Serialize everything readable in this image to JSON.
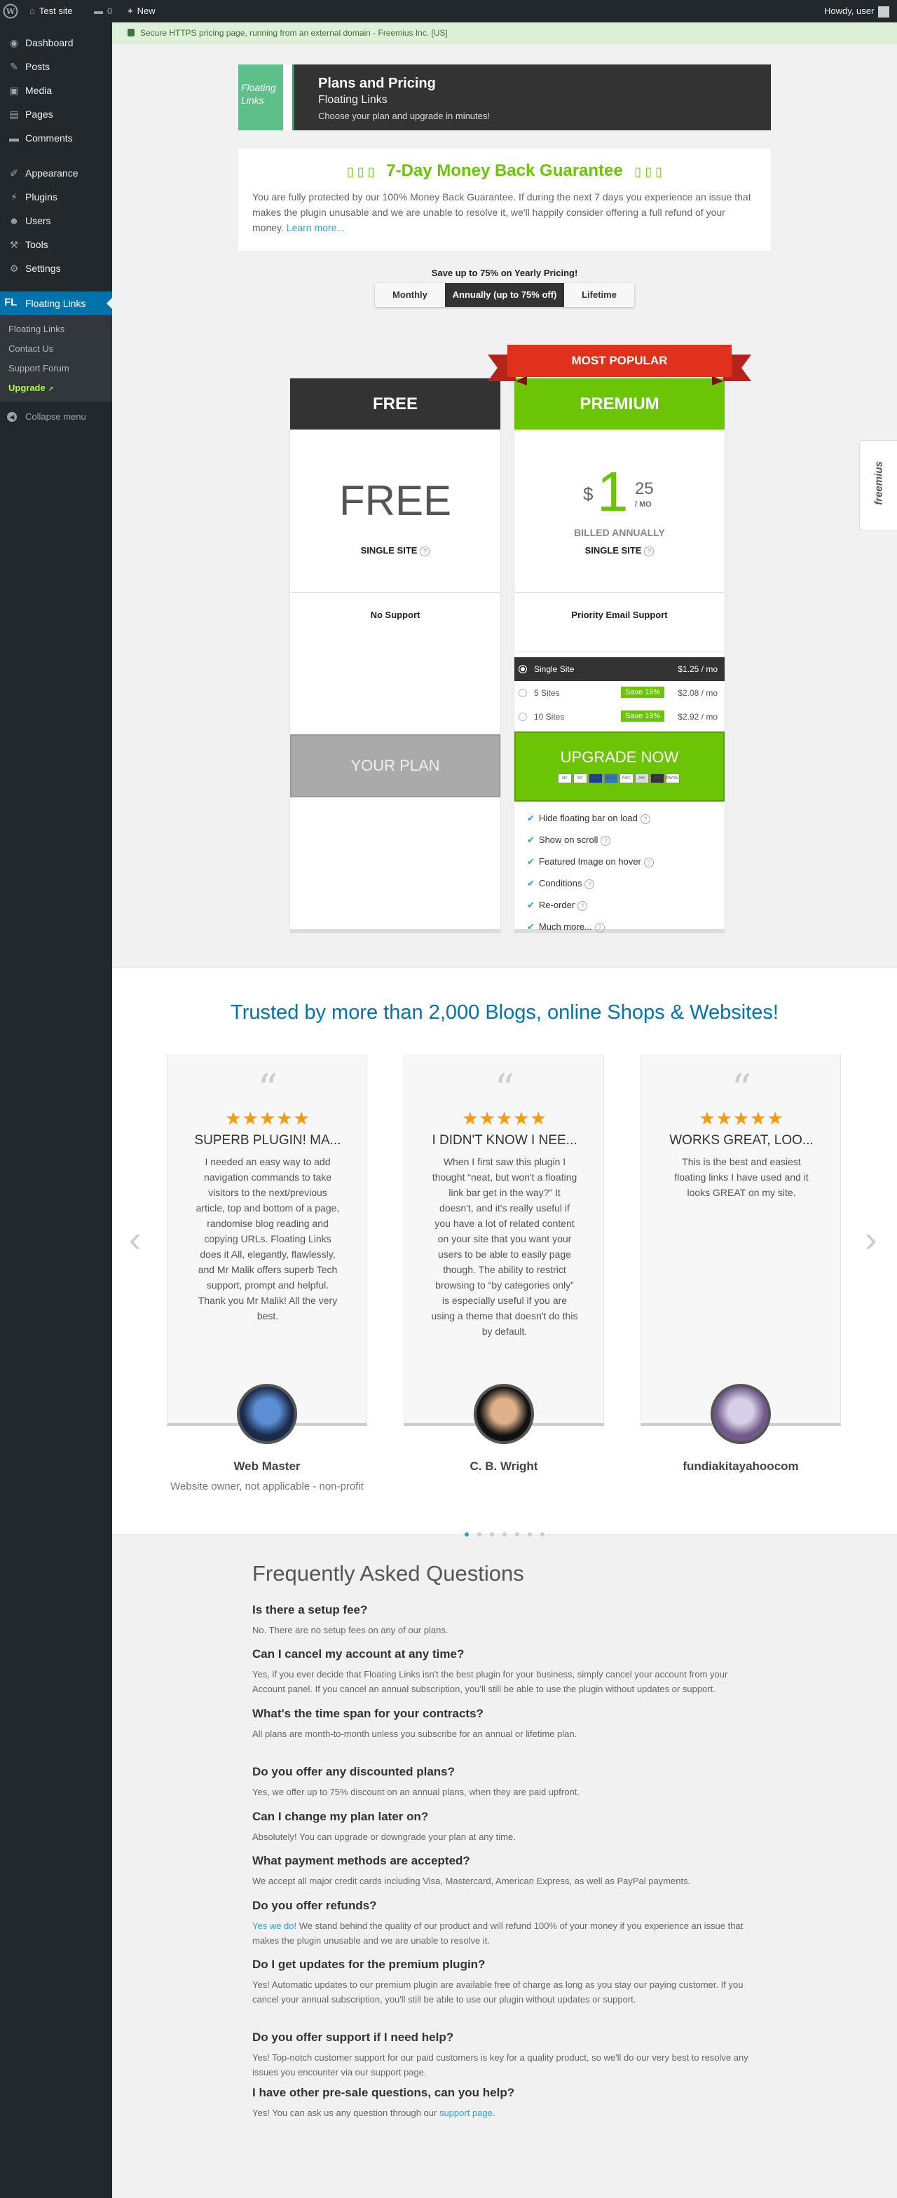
{
  "adminbar": {
    "site": "Test site",
    "comments_count": "0",
    "new_label": "New",
    "howdy": "Howdy, user"
  },
  "sidebar": {
    "items": [
      {
        "label": "Dashboard",
        "icon": "dashboard-icon"
      },
      {
        "label": "Posts",
        "icon": "pin-icon"
      },
      {
        "label": "Media",
        "icon": "media-icon"
      },
      {
        "label": "Pages",
        "icon": "pages-icon"
      },
      {
        "label": "Comments",
        "icon": "comments-icon"
      },
      {
        "label": "Appearance",
        "icon": "brush-icon"
      },
      {
        "label": "Plugins",
        "icon": "plugin-icon"
      },
      {
        "label": "Users",
        "icon": "users-icon"
      },
      {
        "label": "Tools",
        "icon": "wrench-icon"
      },
      {
        "label": "Settings",
        "icon": "settings-icon"
      }
    ],
    "active": {
      "badge": "FL",
      "label": "Floating Links"
    },
    "sub": [
      "Floating Links",
      "Contact Us",
      "Support Forum",
      "Upgrade"
    ],
    "collapse": "Collapse menu"
  },
  "notice": "Secure HTTPS pricing page, running from an external domain - Freemius Inc. [US]",
  "header": {
    "logo_text": "Floating Links",
    "title": "Plans and Pricing",
    "plugin": "Floating Links",
    "tagline": "Choose your plan and upgrade in minutes!"
  },
  "guarantee": {
    "title": "7-Day Money Back Guarantee",
    "text": "You are fully protected by our 100% Money Back Guarantee. If during the next 7 days you experience an issue that makes the plugin unusable and we are unable to resolve it, we'll happily consider offering a full refund of your money.",
    "link": "Learn more..."
  },
  "billing": {
    "promo": "Save up to 75% on Yearly Pricing!",
    "tabs": [
      "Monthly",
      "Annually (up to 75% off)",
      "Lifetime"
    ],
    "selected": 1
  },
  "powered_by": "freemius",
  "free_plan": {
    "name": "FREE",
    "price": "FREE",
    "sites": "SINGLE SITE",
    "support": "No Support",
    "button": "YOUR PLAN"
  },
  "premium_plan": {
    "ribbon": "MOST POPULAR",
    "name": "PREMIUM",
    "currency": "$",
    "price_int": "1",
    "price_dec": "25",
    "per": "/ MO",
    "billed": "BILLED ANNUALLY",
    "sites": "SINGLE SITE",
    "support": "Priority Email Support",
    "licenses": [
      {
        "label": "Single Site",
        "save": "",
        "price": "$1.25 / mo",
        "selected": true
      },
      {
        "label": "5 Sites",
        "save": "Save 16%",
        "price": "$2.08 / mo",
        "selected": false
      },
      {
        "label": "10 Sites",
        "save": "Save 19%",
        "price": "$2.92 / mo",
        "selected": false
      }
    ],
    "button": "UPGRADE NOW",
    "cards": [
      "MC",
      "MC",
      "VISA",
      "AMEX",
      "DISC",
      "PAY",
      "DCL",
      "PAYPAL"
    ],
    "features": [
      "Hide floating bar on load",
      "Show on scroll",
      "Featured Image on hover",
      "Conditions",
      "Re-order",
      "Much more..."
    ]
  },
  "trusted": {
    "title": "Trusted by more than 2,000 Blogs, online Shops & Websites!",
    "prev": "‹",
    "next": "›",
    "testimonials": [
      {
        "title": "SUPERB PLUGIN! MA...",
        "body": "I needed an easy way to add navigation commands to take visitors to the next/previous article, top and bottom of a page, randomise blog reading and copying URLs. Floating Links does it All, elegantly, flawlessly, and Mr Malik offers superb Tech support, prompt and helpful. Thank you Mr Malik! All the very best.",
        "author": "Web Master",
        "role": "Website owner, not applicable - non-profit"
      },
      {
        "title": "I DIDN'T KNOW I NEE...",
        "body": "When I first saw this plugin I thought “neat, but won't a floating link bar get in the way?” It doesn't, and it's really useful if you have a lot of related content on your site that you want your users to be able to easily page though. The ability to restrict browsing to “by categories only” is especially useful if you are using a theme that doesn't do this by default.",
        "author": "C. B. Wright",
        "role": ""
      },
      {
        "title": "WORKS GREAT, LOO...",
        "body": "This is the best and easiest floating links I have used and it looks GREAT on my site.",
        "author": "fundiakitayahoocom",
        "role": ""
      }
    ],
    "stars": "★★★★★",
    "dots_count": 7,
    "active_dot": 0
  },
  "faq": {
    "title": "Frequently Asked Questions",
    "items": [
      {
        "q": "Is there a setup fee?",
        "a": "No. There are no setup fees on any of our plans."
      },
      {
        "q": "Can I cancel my account at any time?",
        "a": "Yes, if you ever decide that Floating Links isn't the best plugin for your business, simply cancel your account from your Account panel. If you cancel an annual subscription, you'll still be able to use the plugin without updates or support."
      },
      {
        "q": "What's the time span for your contracts?",
        "a": "All plans are month-to-month unless you subscribe for an annual or lifetime plan."
      },
      {
        "q": "Do you offer any discounted plans?",
        "a": "Yes, we offer up to 75% discount on an annual plans, when they are paid upfront."
      },
      {
        "q": "Can I change my plan later on?",
        "a": "Absolutely! You can upgrade or downgrade your plan at any time."
      },
      {
        "q": "What payment methods are accepted?",
        "a": "We accept all major credit cards including Visa, Mastercard, American Express, as well as PayPal payments."
      },
      {
        "q": "Do you offer refunds?",
        "a_link": "Yes we do!",
        "a": " We stand behind the quality of our product and will refund 100% of your money if you experience an issue that makes the plugin unusable and we are unable to resolve it."
      },
      {
        "q": "Do I get updates for the premium plugin?",
        "a": "Yes! Automatic updates to our premium plugin are available free of charge as long as you stay our paying customer. If you cancel your annual subscription, you'll still be able to use our plugin without updates or support."
      },
      {
        "q": "Do you offer support if I need help?",
        "a": "Yes! Top-notch customer support for our paid customers is key for a quality product, so we'll do our very best to resolve any issues you encounter via our support page."
      },
      {
        "q": "I have other pre-sale questions, can you help?",
        "a": "Yes! You can ask us any question through our ",
        "a_link2": "support page",
        "a_end": "."
      }
    ]
  },
  "colors": {
    "admin_bg": "#23282d",
    "accent_blue": "#0073aa",
    "premium_green": "#6bc406",
    "ribbon_red": "#e0311d",
    "link": "#2ea2cc"
  }
}
